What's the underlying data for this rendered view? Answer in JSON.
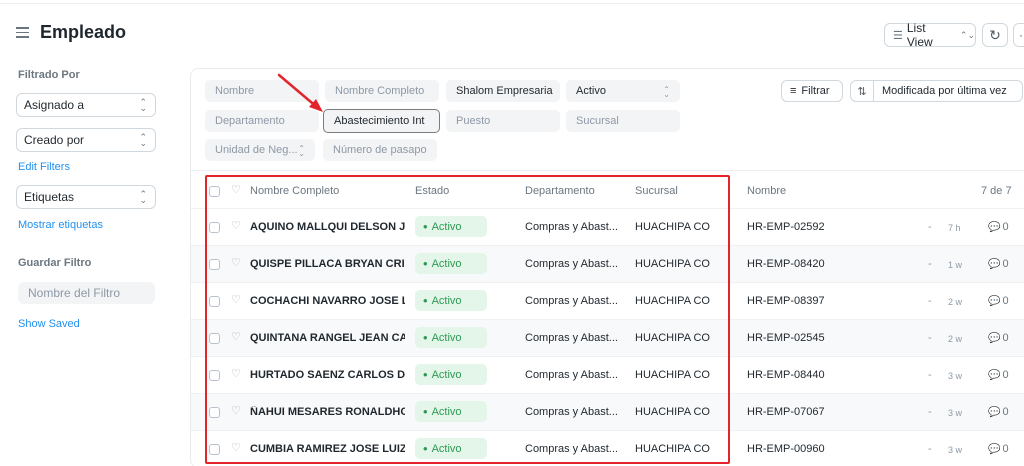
{
  "header": {
    "title": "Empleado",
    "list_view_label": "List View",
    "more_label": "··"
  },
  "sidebar": {
    "filtered_by_label": "Filtrado Por",
    "assigned_to": "Asignado a",
    "created_by": "Creado por",
    "edit_filters": "Edit Filters",
    "tags": "Etiquetas",
    "show_tags": "Mostrar etiquetas",
    "save_filter_label": "Guardar Filtro",
    "filter_name_placeholder": "Nombre del Filtro",
    "show_saved": "Show Saved"
  },
  "filters": {
    "nombre": "Nombre",
    "nombre_completo": "Nombre Completo",
    "empresa": "Shalom Empresaria",
    "estado": "Activo",
    "departamento": "Departamento",
    "departamento_value": "Abastecimiento Int",
    "puesto": "Puesto",
    "sucursal": "Sucursal",
    "unidad": "Unidad de Neg...",
    "pasaporte": "Número de pasapo"
  },
  "toolbar": {
    "filter_label": "Filtrar",
    "sort_label": "Modificada por última vez"
  },
  "table": {
    "headers": {
      "nombre_completo": "Nombre Completo",
      "estado": "Estado",
      "departamento": "Departamento",
      "sucursal": "Sucursal",
      "nombre": "Nombre",
      "count": "7 de 7"
    },
    "rows": [
      {
        "name": "AQUINO MALLQUI DELSON JES",
        "status": "Activo",
        "dept": "Compras y Abast...",
        "branch": "HUACHIPA CO",
        "id": "HR-EMP-02592",
        "dash": "-",
        "time": "7 h",
        "comments": "0"
      },
      {
        "name": "QUISPE PILLACA BRYAN CRIST",
        "status": "Activo",
        "dept": "Compras y Abast...",
        "branch": "HUACHIPA CO",
        "id": "HR-EMP-08420",
        "dash": "-",
        "time": "1 w",
        "comments": "0"
      },
      {
        "name": "COCHACHI NAVARRO JOSE LU",
        "status": "Activo",
        "dept": "Compras y Abast...",
        "branch": "HUACHIPA CO",
        "id": "HR-EMP-08397",
        "dash": "-",
        "time": "2 w",
        "comments": "0"
      },
      {
        "name": "QUINTANA RANGEL JEAN CAR",
        "status": "Activo",
        "dept": "Compras y Abast...",
        "branch": "HUACHIPA CO",
        "id": "HR-EMP-02545",
        "dash": "-",
        "time": "2 w",
        "comments": "0"
      },
      {
        "name": "HURTADO SAENZ CARLOS DA",
        "status": "Activo",
        "dept": "Compras y Abast...",
        "branch": "HUACHIPA CO",
        "id": "HR-EMP-08440",
        "dash": "-",
        "time": "3 w",
        "comments": "0"
      },
      {
        "name": "ÑAHUI MESARES RONALDHO",
        "status": "Activo",
        "dept": "Compras y Abast...",
        "branch": "HUACHIPA CO",
        "id": "HR-EMP-07067",
        "dash": "-",
        "time": "3 w",
        "comments": "0"
      },
      {
        "name": "CUMBIA RAMIREZ JOSE LUIZ",
        "status": "Activo",
        "dept": "Compras y Abast...",
        "branch": "HUACHIPA CO",
        "id": "HR-EMP-00960",
        "dash": "-",
        "time": "3 w",
        "comments": "0"
      }
    ]
  },
  "colors": {
    "accent": "#2490ef",
    "status_green": "#2d9a54",
    "status_bg": "#e4f5e9",
    "annotation_red": "#e3242b"
  },
  "icons": [
    "hamburger-icon",
    "list-icon",
    "refresh-icon",
    "filter-icon",
    "sort-icon",
    "heart-icon",
    "comment-icon",
    "chevron-updown-icon"
  ]
}
